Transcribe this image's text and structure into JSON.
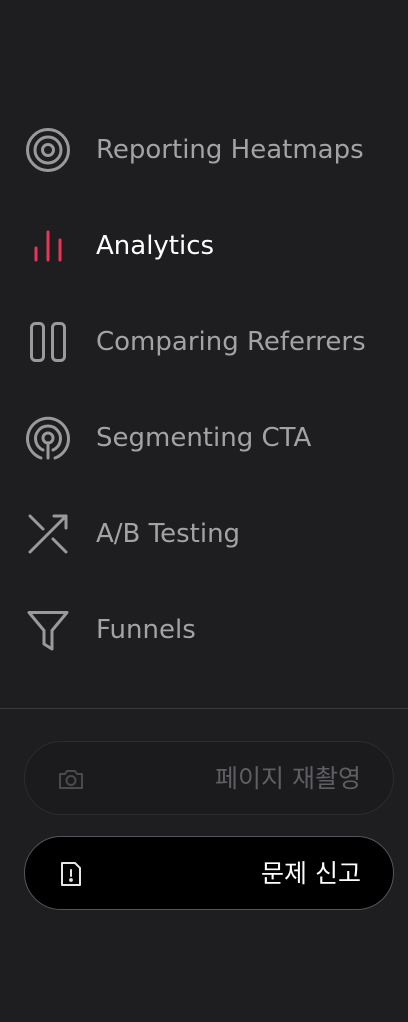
{
  "nav": {
    "items": [
      {
        "label": "Reporting Heatmaps",
        "icon": "target-icon",
        "active": false
      },
      {
        "label": "Analytics",
        "icon": "bar-chart-icon",
        "active": true
      },
      {
        "label": "Comparing Referrers",
        "icon": "columns-icon",
        "active": false
      },
      {
        "label": "Segmenting CTA",
        "icon": "pin-radar-icon",
        "active": false
      },
      {
        "label": "A/B Testing",
        "icon": "shuffle-arrows-icon",
        "active": false
      },
      {
        "label": "Funnels",
        "icon": "funnel-icon",
        "active": false
      }
    ]
  },
  "actions": {
    "retake_label": "페이지 재촬영",
    "retake_icon": "camera-icon",
    "report_label": "문제 신고",
    "report_icon": "report-file-icon"
  },
  "colors": {
    "background": "#1e1e20",
    "icon": "#9a9a9d",
    "active_accent": "#e8355a",
    "active_text": "#ffffff",
    "inactive_text": "#a3a3a6"
  }
}
